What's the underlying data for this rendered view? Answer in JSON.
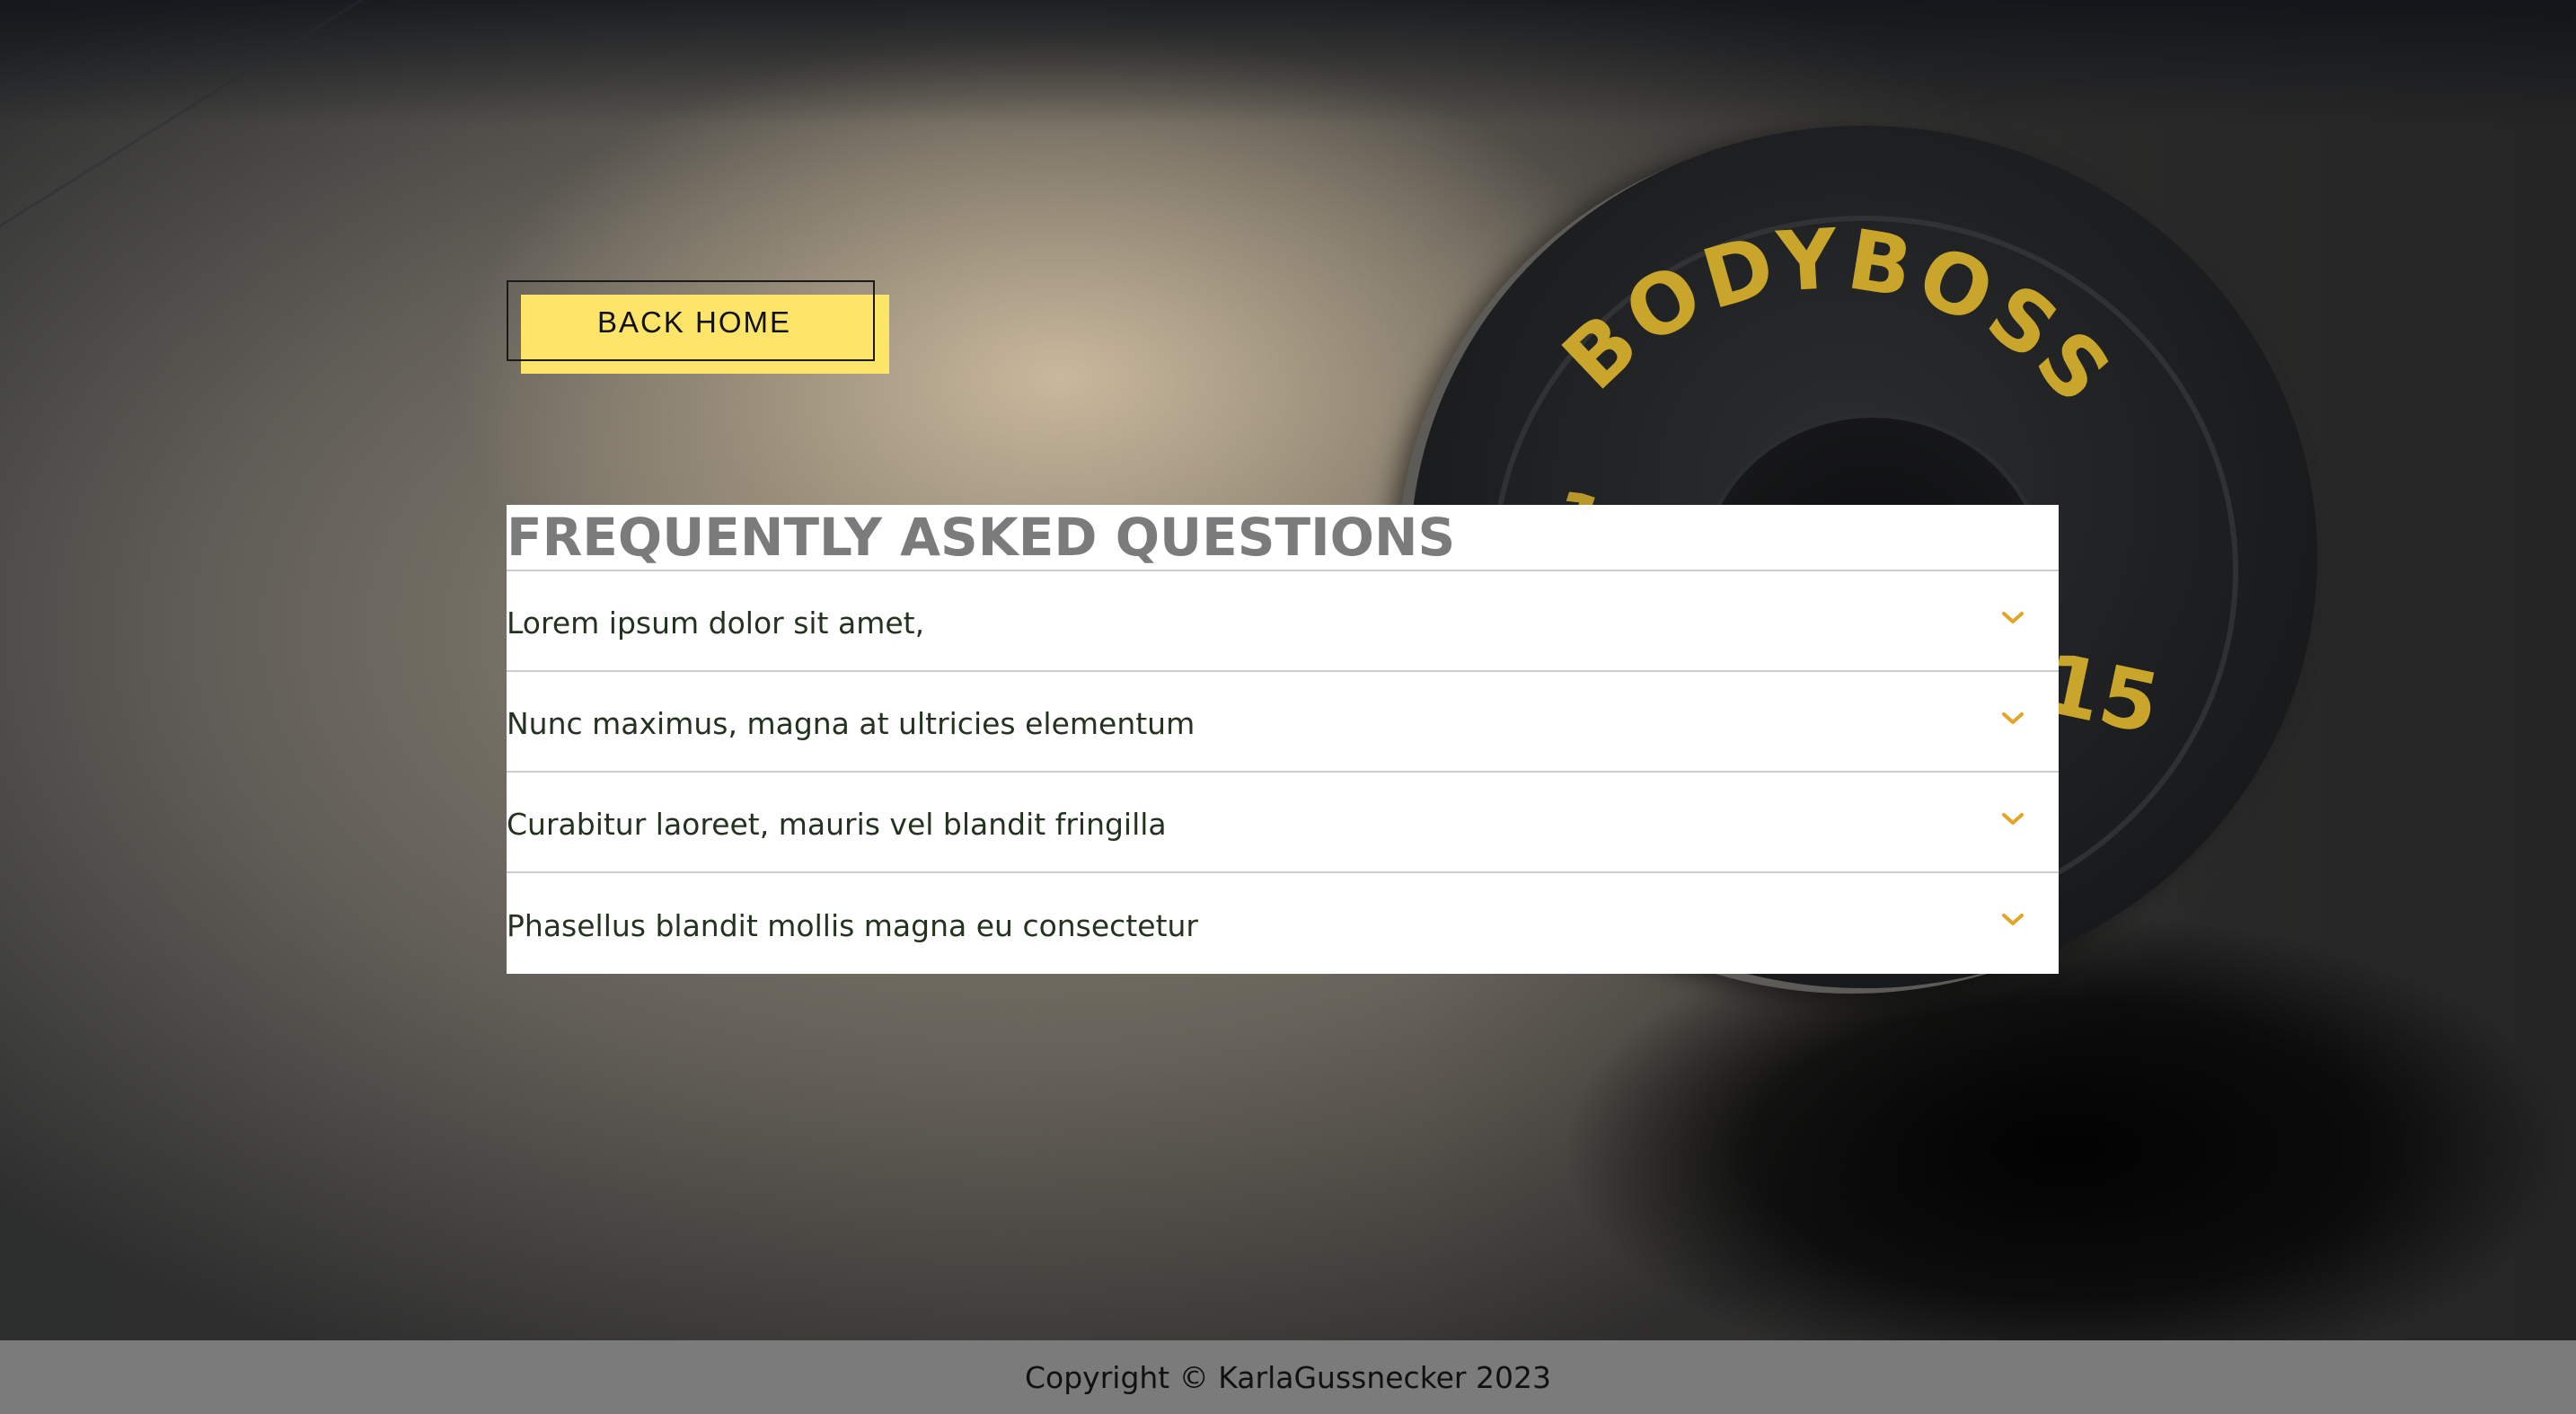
{
  "back_home": {
    "label": "BACK HOME"
  },
  "faq": {
    "title": "FREQUENTLY ASKED QUESTIONS",
    "items": [
      {
        "question": "Lorem ipsum dolor sit amet,",
        "icon": "chevron-down-icon"
      },
      {
        "question": "Nunc maximus, magna at ultricies elementum",
        "icon": "chevron-down-icon"
      },
      {
        "question": "Curabitur laoreet, mauris vel blandit fringilla",
        "icon": "chevron-down-icon"
      },
      {
        "question": "Phasellus blandit mollis magna eu consectetur",
        "icon": "chevron-down-icon"
      }
    ]
  },
  "background_image": {
    "plate_brand": "BODYBOSS",
    "plate_weight": "15"
  },
  "footer": {
    "copyright": "Copyright © KarlaGussnecker 2023"
  },
  "colors": {
    "accent_yellow": "#fde56a",
    "chevron": "#e2a527",
    "title_gray": "#7b7b7b",
    "footer_bg": "#7b7b7b",
    "question_text": "#23331f"
  }
}
